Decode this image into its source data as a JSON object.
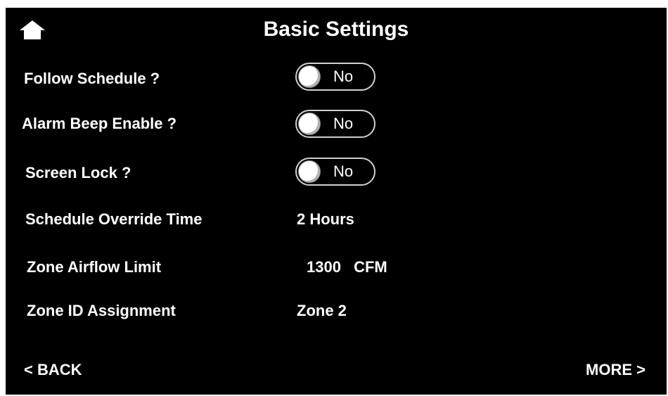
{
  "header": {
    "title": "Basic Settings",
    "home_icon": "home-icon"
  },
  "settings": {
    "follow_schedule": {
      "label": "Follow Schedule ?",
      "value": "No"
    },
    "alarm_beep": {
      "label": "Alarm Beep Enable ?",
      "value": "No"
    },
    "screen_lock": {
      "label": "Screen Lock ?",
      "value": "No"
    },
    "override_time": {
      "label": "Schedule Override Time",
      "value": "2 Hours"
    },
    "airflow_limit": {
      "label": "Zone Airflow Limit",
      "value": "1300",
      "unit": "CFM"
    },
    "zone_id": {
      "label": "Zone ID Assignment",
      "value": "Zone 2"
    }
  },
  "footer": {
    "back_label": "< BACK",
    "more_label": "MORE >"
  },
  "colors": {
    "background": "#000000",
    "text": "#ffffff",
    "toggle_border": "#d0d0d0"
  }
}
